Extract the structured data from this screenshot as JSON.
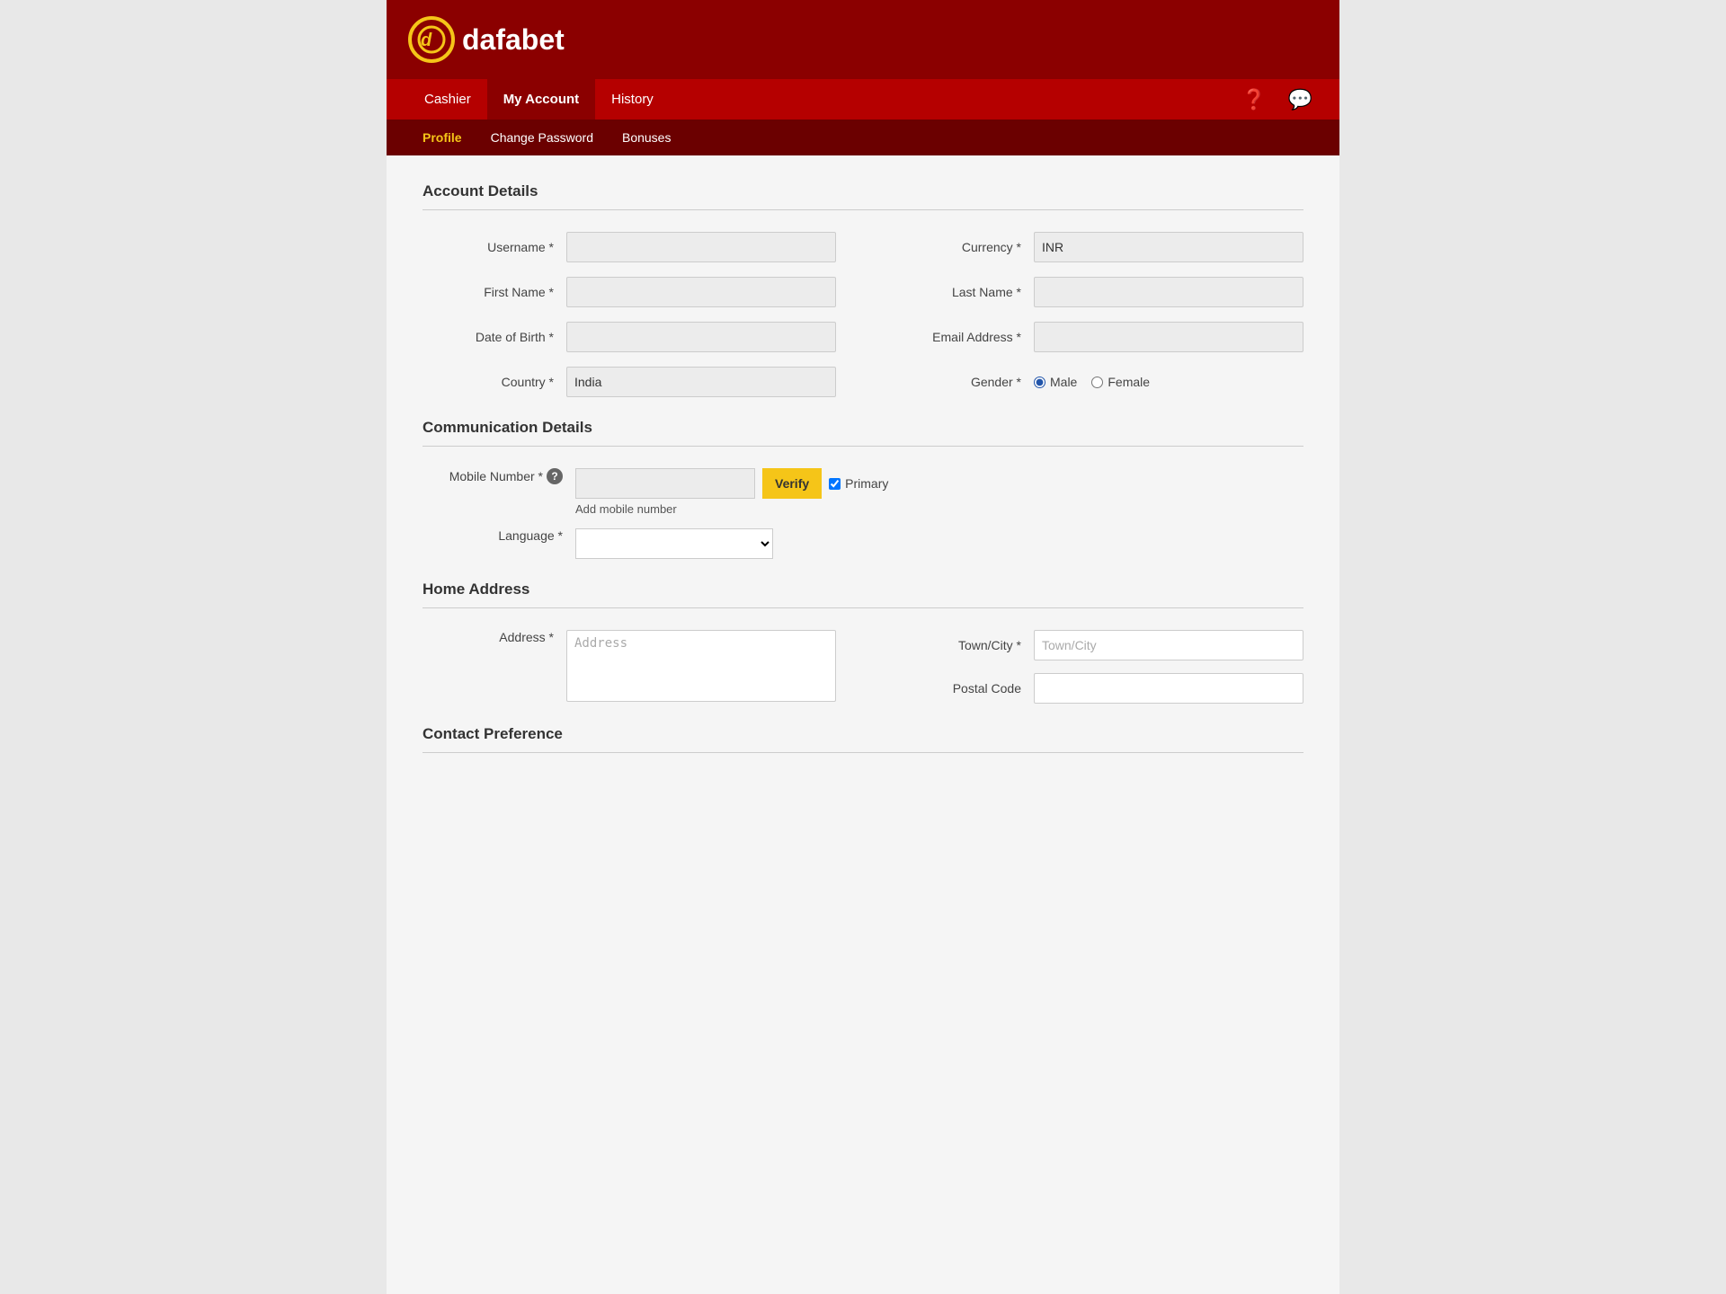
{
  "header": {
    "logo_text": "dafabet"
  },
  "nav": {
    "items": [
      {
        "label": "Cashier",
        "active": false
      },
      {
        "label": "My Account",
        "active": true
      },
      {
        "label": "History",
        "active": false
      }
    ],
    "icons": {
      "help": "?",
      "chat": "💬"
    }
  },
  "sub_nav": {
    "items": [
      {
        "label": "Profile",
        "active": true
      },
      {
        "label": "Change Password",
        "active": false
      },
      {
        "label": "Bonuses",
        "active": false
      }
    ]
  },
  "account_details": {
    "section_title": "Account Details",
    "fields": {
      "username_label": "Username *",
      "username_value": "",
      "currency_label": "Currency *",
      "currency_value": "INR",
      "firstname_label": "First Name *",
      "firstname_value": "",
      "lastname_label": "Last Name *",
      "lastname_value": "",
      "dob_label": "Date of Birth *",
      "dob_value": "",
      "email_label": "Email Address *",
      "email_value": "",
      "country_label": "Country *",
      "country_value": "India",
      "gender_label": "Gender *",
      "gender_male": "Male",
      "gender_female": "Female"
    }
  },
  "communication_details": {
    "section_title": "Communication Details",
    "mobile_label": "Mobile Number *",
    "mobile_value": "",
    "verify_btn": "Verify",
    "primary_label": "Primary",
    "add_mobile_link": "Add mobile number",
    "language_label": "Language *"
  },
  "home_address": {
    "section_title": "Home Address",
    "address_label": "Address *",
    "address_placeholder": "Address",
    "town_label": "Town/City *",
    "town_placeholder": "Town/City",
    "postal_label": "Postal Code",
    "postal_value": ""
  },
  "contact_preference": {
    "section_title": "Contact Preference"
  }
}
